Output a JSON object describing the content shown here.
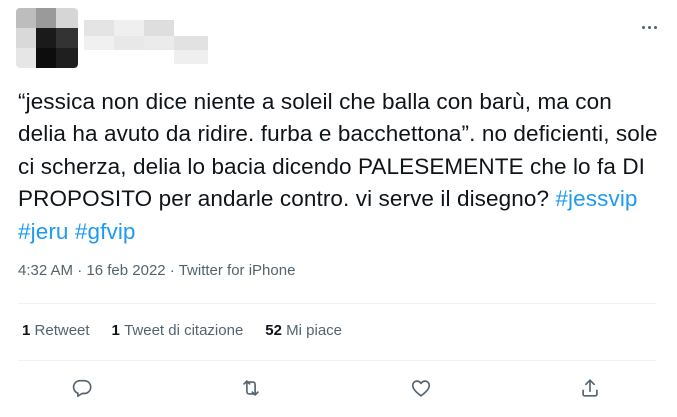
{
  "tweet": {
    "text_parts": {
      "body": "“jessica non dice niente a soleil che balla con barù, ma con delia ha avuto da ridire. furba e bacchettona”. no deficienti, sole ci scherza, delia lo bacia dicendo PALESEMENTE che lo fa DI PROPOSITO per andarle contro. vi serve il disegno? ",
      "hashtag_1": "#jessvip",
      "hashtag_2": "#jeru",
      "hashtag_3": "#gfvip"
    },
    "meta": {
      "time": "4:32 AM",
      "separator_1": " · ",
      "date": "16 feb 2022",
      "separator_2": " · ",
      "source": "Twitter for iPhone"
    },
    "stats": {
      "retweets_count": "1",
      "retweets_label": "Retweet",
      "quotes_count": "1",
      "quotes_label": "Tweet di citazione",
      "likes_count": "52",
      "likes_label": "Mi piace"
    },
    "icons": {
      "more": "more-horizontal-icon",
      "reply": "reply-icon",
      "retweet": "retweet-icon",
      "like": "heart-icon",
      "share": "share-icon"
    }
  },
  "colors": {
    "text": "#0f1419",
    "secondary": "#536471",
    "link": "#1d9bf0",
    "divider": "#eff3f4"
  }
}
